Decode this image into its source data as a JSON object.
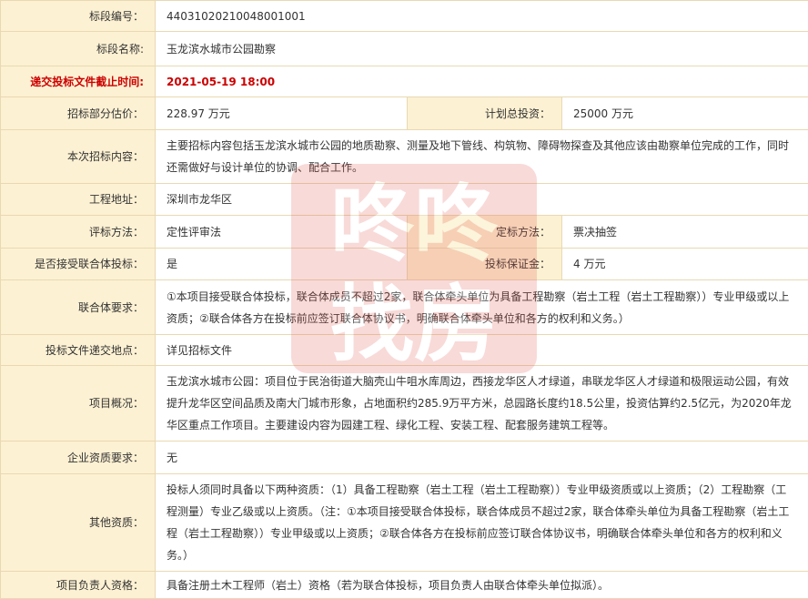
{
  "rows": {
    "section_no": {
      "label": "标段编号：",
      "value": "44031020210048001001"
    },
    "section_name": {
      "label": "标段名称:",
      "value": "玉龙滨水城市公园勘察"
    },
    "deadline": {
      "label": "递交投标文件截止时间:",
      "value": "2021-05-19 18:00"
    },
    "estimate": {
      "label": "招标部分估价：",
      "value": "228.97 万元",
      "label2": "计划总投资：",
      "value2": "25000 万元"
    },
    "content": {
      "label": "本次招标内容：",
      "value": "主要招标内容包括玉龙滨水城市公园的地质勘察、测量及地下管线、构筑物、障碍物探查及其他应该由勘察单位完成的工作，同时还需做好与设计单位的协调、配合工作。"
    },
    "location": {
      "label": "工程地址：",
      "value": "深圳市龙华区"
    },
    "method": {
      "label": "评标方法：",
      "value": "定性评审法",
      "label2": "定标方法：",
      "value2": "票决抽签"
    },
    "consortium": {
      "label": "是否接受联合体投标：",
      "value": "是",
      "label2": "投标保证金：",
      "value2": "4 万元"
    },
    "consortium_req": {
      "label": "联合体要求：",
      "value": "①本项目接受联合体投标，联合体成员不超过2家，联合体牵头单位为具备工程勘察（岩土工程（岩土工程勘察））专业甲级或以上资质；②联合体各方在投标前应签订联合体协议书，明确联合体牵头单位和各方的权利和义务。）"
    },
    "submit_place": {
      "label": "投标文件递交地点：",
      "value": "详见招标文件"
    },
    "overview": {
      "label": "项目概况：",
      "value": "玉龙滨水城市公园：项目位于民治街道大脑壳山牛咀水库周边，西接龙华区人才绿道，串联龙华区人才绿道和极限运动公园，有效提升龙华区空间品质及南大门城市形象，占地面积约285.9万平方米，总园路长度约18.5公里，投资估算约2.5亿元，为2020年龙华区重点工作项目。主要建设内容为园建工程、绿化工程、安装工程、配套服务建筑工程等。"
    },
    "enterprise": {
      "label": "企业资质要求：",
      "value": "无"
    },
    "other_qual": {
      "label": "其他资质：",
      "value": "投标人须同时具备以下两种资质：（1）具备工程勘察（岩土工程（岩土工程勘察））专业甲级资质或以上资质；（2）工程勘察（工程测量）专业乙级或以上资质。（注：①本项目接受联合体投标，联合体成员不超过2家，联合体牵头单位为具备工程勘察（岩土工程（岩土工程勘察））专业甲级或以上资质；②联合体各方在投标前应签订联合体协议书，明确联合体牵头单位和各方的权利和义务。）"
    },
    "pm_qual": {
      "label": "项目负责人资格：",
      "value": "具备注册土木工程师（岩土）资格（若为联合体投标，项目负责人由联合体牵头单位拟派）。"
    }
  },
  "watermark": {
    "text": "咚咚找房",
    "color": "#e05a50"
  }
}
